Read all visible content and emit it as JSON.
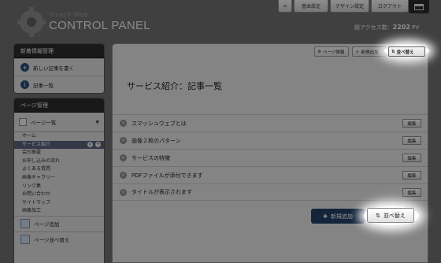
{
  "brand": {
    "small": "Smash Web",
    "big": "CONTROL PANEL"
  },
  "topnav": {
    "home_icon": "home-icon",
    "b1": "基本設定",
    "b2": "デザイン設定",
    "b3": "ログアウト",
    "menu_icon": "window-icon"
  },
  "access": {
    "label": "総アクセス数：",
    "value": "2202",
    "unit": "PV"
  },
  "sidebar": {
    "news": {
      "heading": "新着情報管理",
      "items": [
        {
          "label": "新しい記事を書く",
          "icon": "add-article-icon"
        },
        {
          "label": "記事一覧",
          "icon": "info-icon"
        }
      ]
    },
    "pages": {
      "heading": "ページ管理",
      "dropdown": "ページ一覧",
      "items": [
        "ホーム",
        "サービス紹介",
        "会社概要",
        "お申し込みの流れ",
        "よくある質問",
        "画像ギャラリー",
        "リンク集",
        "お問い合わせ",
        "サイトマップ",
        "画像加工"
      ],
      "tools": [
        "ページ追加",
        "ページ並べ替え"
      ]
    }
  },
  "main": {
    "toolbar": {
      "info": "ページ情報",
      "new": "新規追加",
      "sort": "並べ替え"
    },
    "title": "サービス紹介：記事一覧",
    "rows": [
      {
        "title": "スマッシュウェブとは",
        "edit": "編集"
      },
      {
        "title": "画像２枚のパターン",
        "edit": "編集"
      },
      {
        "title": "サービスの特徴",
        "edit": "編集"
      },
      {
        "title": "PDFファイルが添付できます",
        "edit": "編集"
      },
      {
        "title": "タイトルが表示されます",
        "edit": "編集"
      }
    ],
    "new_button": "新規追加",
    "sort_button": "並べ替え"
  }
}
